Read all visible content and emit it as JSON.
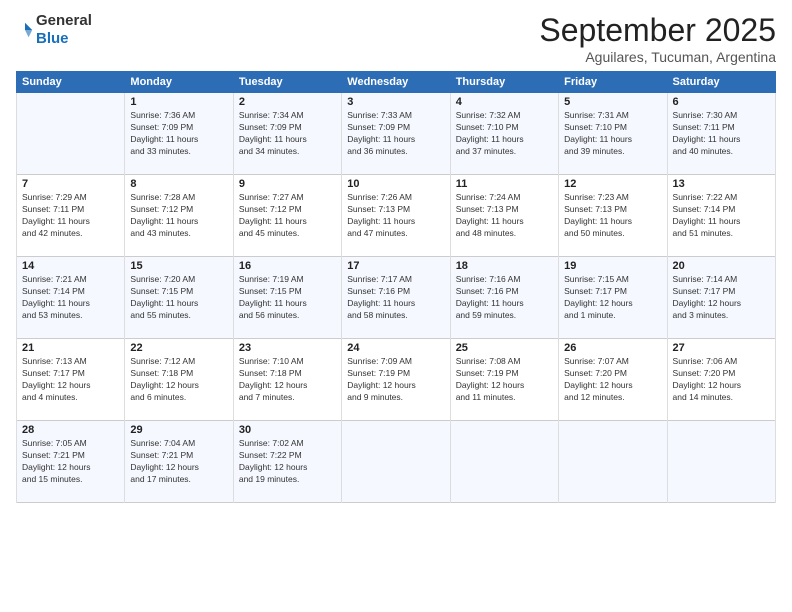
{
  "header": {
    "logo_line1": "General",
    "logo_line2": "Blue",
    "month_title": "September 2025",
    "subtitle": "Aguilares, Tucuman, Argentina"
  },
  "days_of_week": [
    "Sunday",
    "Monday",
    "Tuesday",
    "Wednesday",
    "Thursday",
    "Friday",
    "Saturday"
  ],
  "weeks": [
    [
      {
        "day": "",
        "info": ""
      },
      {
        "day": "1",
        "info": "Sunrise: 7:36 AM\nSunset: 7:09 PM\nDaylight: 11 hours\nand 33 minutes."
      },
      {
        "day": "2",
        "info": "Sunrise: 7:34 AM\nSunset: 7:09 PM\nDaylight: 11 hours\nand 34 minutes."
      },
      {
        "day": "3",
        "info": "Sunrise: 7:33 AM\nSunset: 7:09 PM\nDaylight: 11 hours\nand 36 minutes."
      },
      {
        "day": "4",
        "info": "Sunrise: 7:32 AM\nSunset: 7:10 PM\nDaylight: 11 hours\nand 37 minutes."
      },
      {
        "day": "5",
        "info": "Sunrise: 7:31 AM\nSunset: 7:10 PM\nDaylight: 11 hours\nand 39 minutes."
      },
      {
        "day": "6",
        "info": "Sunrise: 7:30 AM\nSunset: 7:11 PM\nDaylight: 11 hours\nand 40 minutes."
      }
    ],
    [
      {
        "day": "7",
        "info": "Sunrise: 7:29 AM\nSunset: 7:11 PM\nDaylight: 11 hours\nand 42 minutes."
      },
      {
        "day": "8",
        "info": "Sunrise: 7:28 AM\nSunset: 7:12 PM\nDaylight: 11 hours\nand 43 minutes."
      },
      {
        "day": "9",
        "info": "Sunrise: 7:27 AM\nSunset: 7:12 PM\nDaylight: 11 hours\nand 45 minutes."
      },
      {
        "day": "10",
        "info": "Sunrise: 7:26 AM\nSunset: 7:13 PM\nDaylight: 11 hours\nand 47 minutes."
      },
      {
        "day": "11",
        "info": "Sunrise: 7:24 AM\nSunset: 7:13 PM\nDaylight: 11 hours\nand 48 minutes."
      },
      {
        "day": "12",
        "info": "Sunrise: 7:23 AM\nSunset: 7:13 PM\nDaylight: 11 hours\nand 50 minutes."
      },
      {
        "day": "13",
        "info": "Sunrise: 7:22 AM\nSunset: 7:14 PM\nDaylight: 11 hours\nand 51 minutes."
      }
    ],
    [
      {
        "day": "14",
        "info": "Sunrise: 7:21 AM\nSunset: 7:14 PM\nDaylight: 11 hours\nand 53 minutes."
      },
      {
        "day": "15",
        "info": "Sunrise: 7:20 AM\nSunset: 7:15 PM\nDaylight: 11 hours\nand 55 minutes."
      },
      {
        "day": "16",
        "info": "Sunrise: 7:19 AM\nSunset: 7:15 PM\nDaylight: 11 hours\nand 56 minutes."
      },
      {
        "day": "17",
        "info": "Sunrise: 7:17 AM\nSunset: 7:16 PM\nDaylight: 11 hours\nand 58 minutes."
      },
      {
        "day": "18",
        "info": "Sunrise: 7:16 AM\nSunset: 7:16 PM\nDaylight: 11 hours\nand 59 minutes."
      },
      {
        "day": "19",
        "info": "Sunrise: 7:15 AM\nSunset: 7:17 PM\nDaylight: 12 hours\nand 1 minute."
      },
      {
        "day": "20",
        "info": "Sunrise: 7:14 AM\nSunset: 7:17 PM\nDaylight: 12 hours\nand 3 minutes."
      }
    ],
    [
      {
        "day": "21",
        "info": "Sunrise: 7:13 AM\nSunset: 7:17 PM\nDaylight: 12 hours\nand 4 minutes."
      },
      {
        "day": "22",
        "info": "Sunrise: 7:12 AM\nSunset: 7:18 PM\nDaylight: 12 hours\nand 6 minutes."
      },
      {
        "day": "23",
        "info": "Sunrise: 7:10 AM\nSunset: 7:18 PM\nDaylight: 12 hours\nand 7 minutes."
      },
      {
        "day": "24",
        "info": "Sunrise: 7:09 AM\nSunset: 7:19 PM\nDaylight: 12 hours\nand 9 minutes."
      },
      {
        "day": "25",
        "info": "Sunrise: 7:08 AM\nSunset: 7:19 PM\nDaylight: 12 hours\nand 11 minutes."
      },
      {
        "day": "26",
        "info": "Sunrise: 7:07 AM\nSunset: 7:20 PM\nDaylight: 12 hours\nand 12 minutes."
      },
      {
        "day": "27",
        "info": "Sunrise: 7:06 AM\nSunset: 7:20 PM\nDaylight: 12 hours\nand 14 minutes."
      }
    ],
    [
      {
        "day": "28",
        "info": "Sunrise: 7:05 AM\nSunset: 7:21 PM\nDaylight: 12 hours\nand 15 minutes."
      },
      {
        "day": "29",
        "info": "Sunrise: 7:04 AM\nSunset: 7:21 PM\nDaylight: 12 hours\nand 17 minutes."
      },
      {
        "day": "30",
        "info": "Sunrise: 7:02 AM\nSunset: 7:22 PM\nDaylight: 12 hours\nand 19 minutes."
      },
      {
        "day": "",
        "info": ""
      },
      {
        "day": "",
        "info": ""
      },
      {
        "day": "",
        "info": ""
      },
      {
        "day": "",
        "info": ""
      }
    ]
  ]
}
